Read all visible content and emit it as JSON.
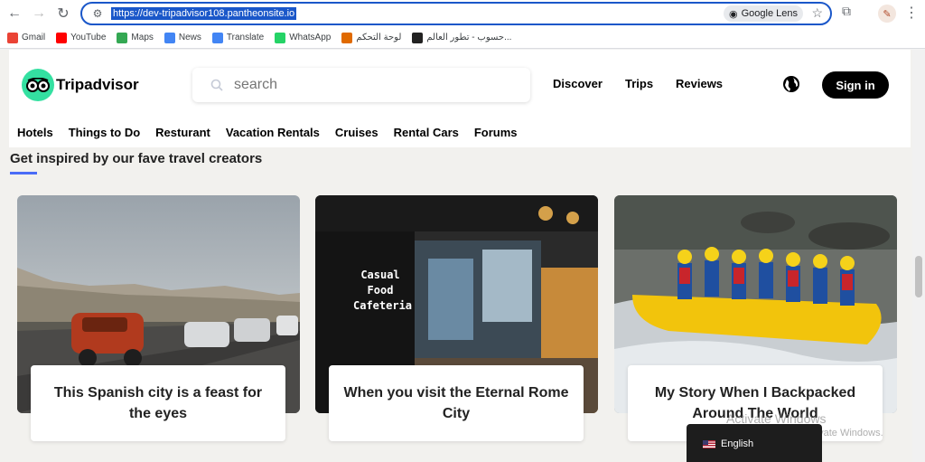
{
  "browser": {
    "url": "https://dev-tripadvisor108.pantheonsite.io",
    "lens_label": "Google Lens"
  },
  "bookmarks": [
    {
      "label": "Gmail",
      "icon": "gmail-icon",
      "color": "#ea4335"
    },
    {
      "label": "YouTube",
      "icon": "youtube-icon",
      "color": "#ff0000"
    },
    {
      "label": "Maps",
      "icon": "maps-icon",
      "color": "#34a853"
    },
    {
      "label": "News",
      "icon": "news-icon",
      "color": "#4285f4"
    },
    {
      "label": "Translate",
      "icon": "translate-icon",
      "color": "#4285f4"
    },
    {
      "label": "WhatsApp",
      "icon": "whatsapp-icon",
      "color": "#25d366"
    },
    {
      "label": "لوحة التحكم",
      "icon": "dashboard-icon",
      "color": "#e06a00"
    },
    {
      "label": "حسوب - تطور العالم...",
      "icon": "hsoub-icon",
      "color": "#222222"
    }
  ],
  "site": {
    "logo_text": "Tripadvisor",
    "search_placeholder": "search",
    "nav": [
      "Discover",
      "Trips",
      "Reviews"
    ],
    "signin_label": "Sign in",
    "subnav": [
      "Hotels",
      "Things to Do",
      "Resturant",
      "Vacation Rentals",
      "Cruises",
      "Rental Cars",
      "Forums"
    ]
  },
  "section": {
    "title": "Get inspired by our fave travel creators",
    "accent": "#4a6cf7",
    "cards": [
      {
        "caption": "This Spanish city is a feast for the eyes",
        "image": "desert-road-vintage-car"
      },
      {
        "caption": "When you visit the Eternal Rome City",
        "image": "cafeteria-interior",
        "sign": "Casual Food Cafeteria"
      },
      {
        "caption": "My Story When I Backpacked Around The World",
        "image": "whitewater-rafting"
      }
    ]
  },
  "overlay": {
    "activate_title": "Activate Windows",
    "activate_sub": "Go to Settings to activate Windows.",
    "language": "English"
  }
}
